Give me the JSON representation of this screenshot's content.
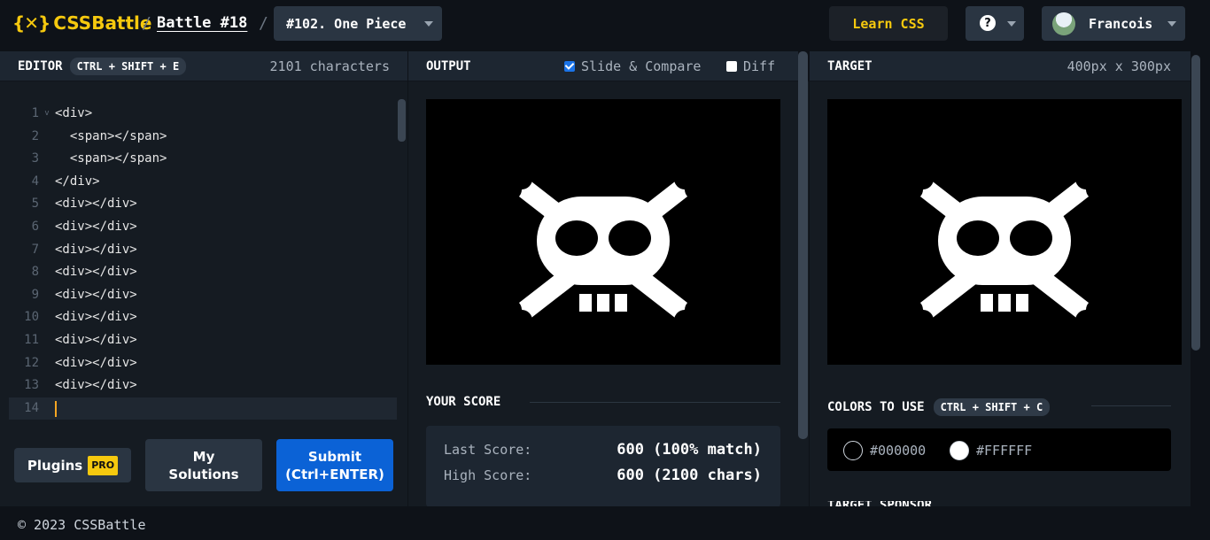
{
  "header": {
    "logo_mark": "{✕}",
    "logo_text": "CSSBattle",
    "separator": "/",
    "battle_link": "Battle #18",
    "target_selector": "#102. One Piece",
    "learn_css": "Learn CSS",
    "help_label": "?",
    "user_name": "Francois"
  },
  "editor": {
    "title": "EDITOR",
    "shortcut": "CTRL + SHIFT + E",
    "char_count": "2101 characters",
    "lines": [
      {
        "n": "1",
        "code": "<div>"
      },
      {
        "n": "2",
        "code": "  <span></span>"
      },
      {
        "n": "3",
        "code": "  <span></span>"
      },
      {
        "n": "4",
        "code": "</div>"
      },
      {
        "n": "5",
        "code": "<div></div>"
      },
      {
        "n": "6",
        "code": "<div></div>"
      },
      {
        "n": "7",
        "code": "<div></div>"
      },
      {
        "n": "8",
        "code": "<div></div>"
      },
      {
        "n": "9",
        "code": "<div></div>"
      },
      {
        "n": "10",
        "code": "<div></div>"
      },
      {
        "n": "11",
        "code": "<div></div>"
      },
      {
        "n": "12",
        "code": "<div></div>"
      },
      {
        "n": "13",
        "code": "<div></div>"
      },
      {
        "n": "14",
        "code": ""
      }
    ],
    "plugins_label": "Plugins",
    "pro_badge": "PRO",
    "my_solutions_line1": "My",
    "my_solutions_line2": "Solutions",
    "submit_line1": "Submit",
    "submit_line2": "(Ctrl+ENTER)"
  },
  "output": {
    "title": "OUTPUT",
    "slide_compare_label": "Slide & Compare",
    "slide_compare_checked": true,
    "diff_label": "Diff",
    "diff_checked": false
  },
  "score": {
    "title": "YOUR SCORE",
    "last_label": "Last Score:",
    "last_value": "600 (100% match)",
    "high_label": "High Score:",
    "high_value": "600 (2100 chars)"
  },
  "target": {
    "title": "TARGET",
    "size": "400px x 300px",
    "colors_title": "COLORS TO USE",
    "colors_shortcut": "CTRL + SHIFT + C",
    "colors": [
      {
        "hex": "#000000",
        "label": "#000000"
      },
      {
        "hex": "#FFFFFF",
        "label": "#FFFFFF"
      }
    ],
    "sponsor_title": "TARGET SPONSOR"
  },
  "footer": {
    "copyright": "© 2023 CSSBattle"
  },
  "theme": {
    "accent_yellow": "#f6c90e",
    "submit_blue": "#0b62d6",
    "canvas_bg": "#000000",
    "art_fg": "#FFFFFF"
  }
}
